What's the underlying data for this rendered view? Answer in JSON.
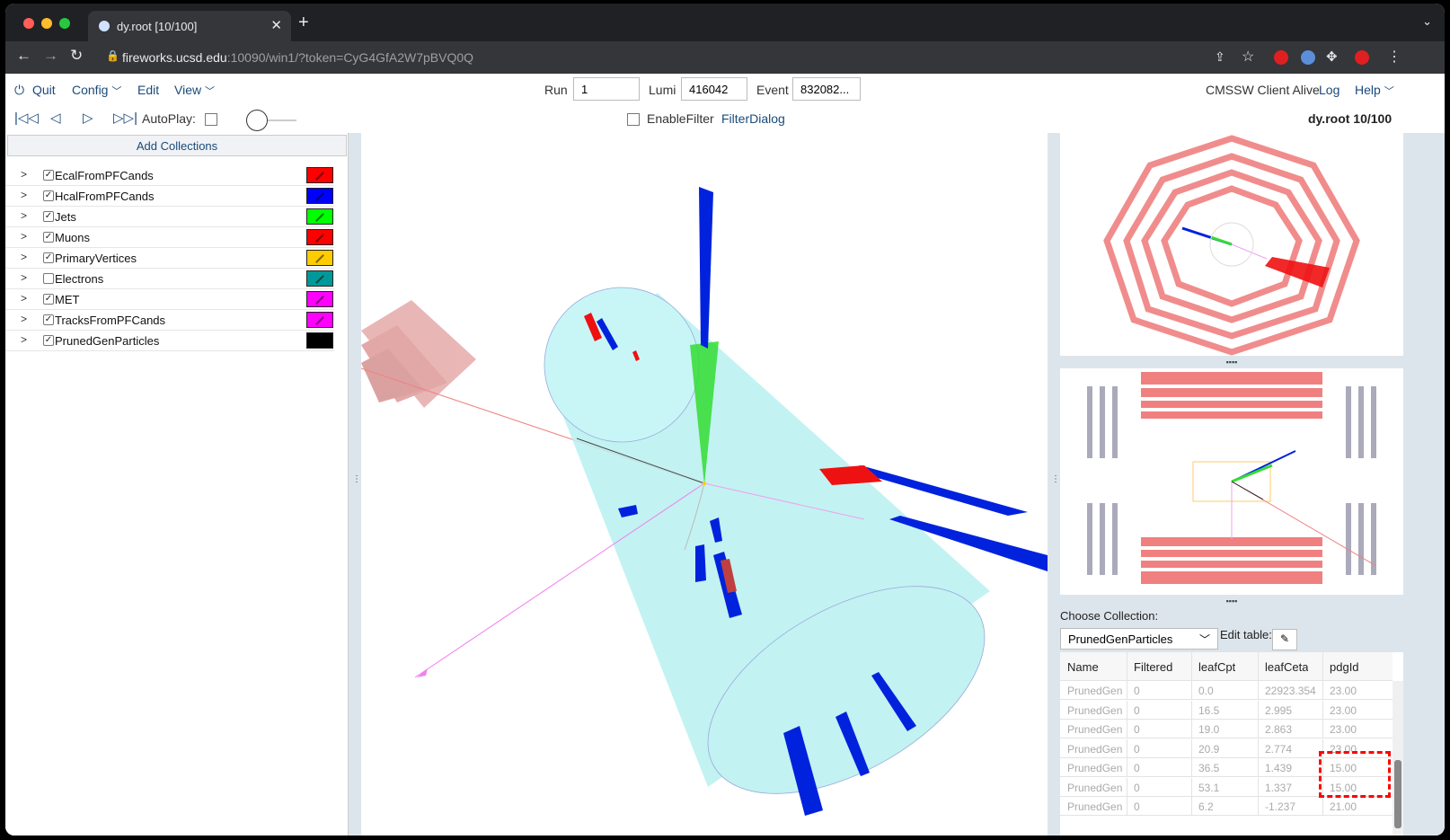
{
  "browser": {
    "tab_title": "dy.root [10/100]",
    "url_host": "fireworks.ucsd.edu",
    "url_rest": ":10090/win1/?token=CyG4GfA2W7pBVQ0Q",
    "newtab_symbol": "+",
    "close_symbol": "✕"
  },
  "menu": {
    "quit": "Quit",
    "config": "Config",
    "edit": "Edit",
    "view": "View"
  },
  "event_fields": {
    "run_label": "Run",
    "run_value": "1",
    "lumi_label": "Lumi",
    "lumi_value": "416042",
    "event_label": "Event",
    "event_value": "832082..."
  },
  "status": {
    "client": "CMSSW Client Alive",
    "log": "Log",
    "help": "Help"
  },
  "playback": {
    "autoplay_label": "AutoPlay:",
    "enable_filter": "EnableFilter",
    "filter_dialog": "FilterDialog",
    "file_name": "dy.root",
    "file_position": "10/100"
  },
  "collections_panel": {
    "add_button": "Add Collections",
    "items": [
      {
        "label": "EcalFromPFCands",
        "checked": true,
        "color": "#ff0000"
      },
      {
        "label": "HcalFromPFCands",
        "checked": true,
        "color": "#0000ff"
      },
      {
        "label": "Jets",
        "checked": true,
        "color": "#00ff00"
      },
      {
        "label": "Muons",
        "checked": true,
        "color": "#ff0000"
      },
      {
        "label": "PrimaryVertices",
        "checked": true,
        "color": "#ffcc00"
      },
      {
        "label": "Electrons",
        "checked": false,
        "color": "#009999"
      },
      {
        "label": "MET",
        "checked": true,
        "color": "#ff00ff"
      },
      {
        "label": "TracksFromPFCands",
        "checked": true,
        "color": "#ff00ff"
      },
      {
        "label": "PrunedGenParticles",
        "checked": true,
        "color": "#000000"
      }
    ]
  },
  "table_panel": {
    "choose_label": "Choose Collection:",
    "selected_collection": "PrunedGenParticles",
    "edit_table_label": "Edit table:",
    "columns": [
      "Name",
      "Filtered",
      "leafCpt",
      "leafCeta",
      "pdgId"
    ],
    "rows": [
      [
        "PrunedGen",
        "0",
        "0.0",
        "22923.354",
        "23.00"
      ],
      [
        "PrunedGen",
        "0",
        "16.5",
        "2.995",
        "23.00"
      ],
      [
        "PrunedGen",
        "0",
        "19.0",
        "2.863",
        "23.00"
      ],
      [
        "PrunedGen",
        "0",
        "20.9",
        "2.774",
        "23.00"
      ],
      [
        "PrunedGen",
        "0",
        "36.5",
        "1.439",
        "15.00"
      ],
      [
        "PrunedGen",
        "0",
        "53.1",
        "1.337",
        "15.00"
      ],
      [
        "PrunedGen",
        "0",
        "6.2",
        "-1.237",
        "21.00"
      ]
    ]
  },
  "colors": {
    "link_blue": "#1a4a7a",
    "detector_red": "#f08080",
    "cone_cyan": "#b8f0f0",
    "jet_green": "#33dd33",
    "hcal_blue": "#0022dd",
    "highlight_red": "#ff0000"
  }
}
